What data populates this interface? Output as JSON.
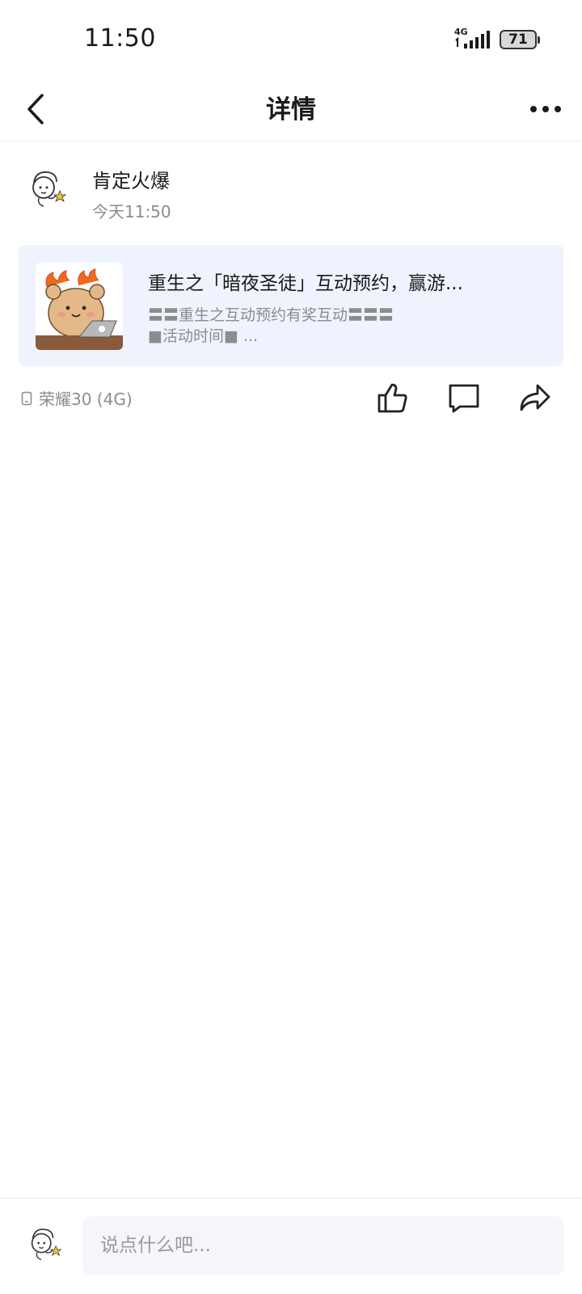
{
  "status_bar": {
    "time": "11:50",
    "network": "4G",
    "battery": "71",
    "icons": [
      "signal-icon",
      "battery-icon"
    ]
  },
  "header": {
    "title": "详情",
    "back_icon": "chevron-left-icon",
    "more_icon": "more-horizontal-icon"
  },
  "post": {
    "author": "肯定火爆",
    "time": "今天11:50",
    "shared_card": {
      "title": "重生之「暗夜圣徒」互动预约，赢游...",
      "desc_line1": "〓〓重生之互动预约有奖互动〓〓〓",
      "desc_line2": "■活动时间■ ..."
    },
    "device": "荣耀30 (4G)",
    "actions": {
      "like_icon": "thumbs-up-icon",
      "comment_icon": "comment-icon",
      "share_icon": "share-icon"
    }
  },
  "comment_bar": {
    "placeholder": "说点什么吧..."
  },
  "colors": {
    "card_bg": "#eef3fd",
    "muted_text": "#8c8c8c",
    "input_bg": "#f4f6fb"
  }
}
